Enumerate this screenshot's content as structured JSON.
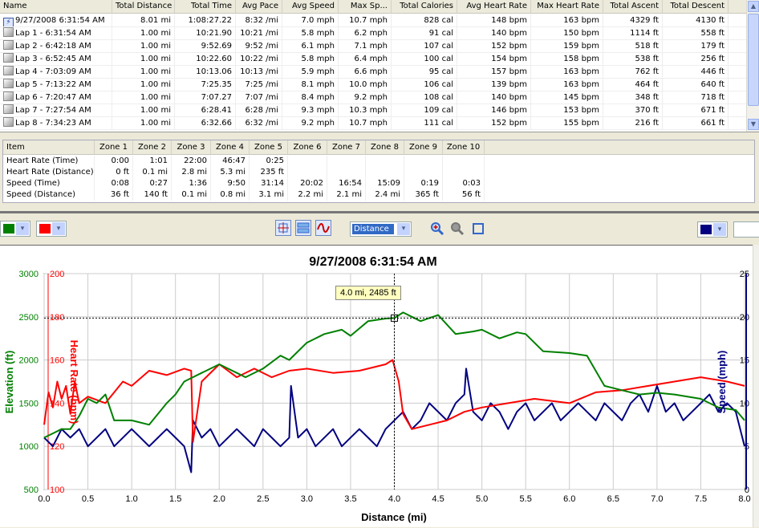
{
  "laps_table": {
    "columns": [
      "Name",
      "Total Distance",
      "Total Time",
      "Avg Pace",
      "Avg Speed",
      "Max Sp...",
      "Total Calories",
      "Avg Heart Rate",
      "Max Heart Rate",
      "Total Ascent",
      "Total Descent"
    ],
    "rows": [
      {
        "icon": "running-activity-icon",
        "cells": [
          "9/27/2008 6:31:54 AM",
          "8.01 mi",
          "1:08:27.22",
          "8:32 /mi",
          "7.0 mph",
          "10.7 mph",
          "828 cal",
          "148 bpm",
          "163 bpm",
          "4329 ft",
          "4130 ft"
        ]
      },
      {
        "icon": "lap-icon",
        "cells": [
          "Lap 1 - 6:31:54 AM",
          "1.00 mi",
          "10:21.90",
          "10:21 /mi",
          "5.8 mph",
          "6.2 mph",
          "91 cal",
          "140 bpm",
          "150 bpm",
          "1114 ft",
          "558 ft"
        ]
      },
      {
        "icon": "lap-icon",
        "cells": [
          "Lap 2 - 6:42:18 AM",
          "1.00 mi",
          "9:52.69",
          "9:52 /mi",
          "6.1 mph",
          "7.1 mph",
          "107 cal",
          "152 bpm",
          "159 bpm",
          "518 ft",
          "179 ft"
        ]
      },
      {
        "icon": "lap-icon",
        "cells": [
          "Lap 3 - 6:52:45 AM",
          "1.00 mi",
          "10:22.60",
          "10:22 /mi",
          "5.8 mph",
          "6.4 mph",
          "100 cal",
          "154 bpm",
          "158 bpm",
          "538 ft",
          "256 ft"
        ]
      },
      {
        "icon": "lap-icon",
        "cells": [
          "Lap 4 - 7:03:09 AM",
          "1.00 mi",
          "10:13.06",
          "10:13 /mi",
          "5.9 mph",
          "6.6 mph",
          "95 cal",
          "157 bpm",
          "163 bpm",
          "762 ft",
          "446 ft"
        ]
      },
      {
        "icon": "lap-icon",
        "cells": [
          "Lap 5 - 7:13:22 AM",
          "1.00 mi",
          "7:25.35",
          "7:25 /mi",
          "8.1 mph",
          "10.0 mph",
          "106 cal",
          "139 bpm",
          "163 bpm",
          "464 ft",
          "640 ft"
        ]
      },
      {
        "icon": "lap-icon",
        "cells": [
          "Lap 6 - 7:20:47 AM",
          "1.00 mi",
          "7:07.27",
          "7:07 /mi",
          "8.4 mph",
          "9.2 mph",
          "108 cal",
          "140 bpm",
          "145 bpm",
          "348 ft",
          "718 ft"
        ]
      },
      {
        "icon": "lap-icon",
        "cells": [
          "Lap 7 - 7:27:54 AM",
          "1.00 mi",
          "6:28.41",
          "6:28 /mi",
          "9.3 mph",
          "10.3 mph",
          "109 cal",
          "146 bpm",
          "153 bpm",
          "370 ft",
          "671 ft"
        ]
      },
      {
        "icon": "lap-icon",
        "cells": [
          "Lap 8 - 7:34:23 AM",
          "1.00 mi",
          "6:32.66",
          "6:32 /mi",
          "9.2 mph",
          "10.7 mph",
          "111 cal",
          "152 bpm",
          "155 bpm",
          "216 ft",
          "661 ft"
        ]
      }
    ]
  },
  "zones_table": {
    "columns": [
      "Item",
      "Zone 1",
      "Zone 2",
      "Zone 3",
      "Zone 4",
      "Zone 5",
      "Zone 6",
      "Zone 7",
      "Zone 8",
      "Zone 9",
      "Zone 10"
    ],
    "rows": [
      [
        "Heart Rate (Time)",
        "0:00",
        "1:01",
        "22:00",
        "46:47",
        "0:25",
        "",
        "",
        "",
        "",
        ""
      ],
      [
        "Heart Rate (Distance)",
        "0 ft",
        "0.1 mi",
        "2.8 mi",
        "5.3 mi",
        "235 ft",
        "",
        "",
        "",
        "",
        ""
      ],
      [
        "Speed (Time)",
        "0:08",
        "0:27",
        "1:36",
        "9:50",
        "31:14",
        "20:02",
        "16:54",
        "15:09",
        "0:19",
        "0:03"
      ],
      [
        "Speed (Distance)",
        "36 ft",
        "140 ft",
        "0.1 mi",
        "0.8 mi",
        "3.1 mi",
        "2.2 mi",
        "2.1 mi",
        "2.4 mi",
        "365 ft",
        "56 ft"
      ]
    ]
  },
  "toolbar": {
    "left_colors": [
      "#008000",
      "#ff0000"
    ],
    "right_colors": [
      "#000080",
      "#ffffff"
    ],
    "view_buttons": [
      "crosshair-icon",
      "split-chart-icon",
      "smoothing-icon"
    ],
    "x_axis_select": "Distance",
    "zoom_buttons": [
      "zoom-in-icon",
      "zoom-out-icon",
      "zoom-fit-icon"
    ]
  },
  "chart_data": {
    "type": "line",
    "title": "9/27/2008 6:31:54 AM",
    "xlabel": "Distance (mi)",
    "xlim": [
      0,
      8
    ],
    "xticks": [
      "0.0",
      "0.5",
      "1.0",
      "1.5",
      "2.0",
      "2.5",
      "3.0",
      "3.5",
      "4.0",
      "4.5",
      "5.0",
      "5.5",
      "6.0",
      "6.5",
      "7.0",
      "7.5",
      "8.0"
    ],
    "grid": true,
    "axes": {
      "elevation": {
        "label": "Elevation (ft)",
        "lim": [
          500,
          3000
        ],
        "ticks": [
          "3000",
          "2500",
          "2000",
          "1500",
          "1000",
          "500"
        ],
        "color": "#008000"
      },
      "heart_rate": {
        "label": "Heart Rate (bpm)",
        "lim": [
          100,
          200
        ],
        "ticks": [
          "200",
          "180",
          "160",
          "140",
          "120",
          "100"
        ],
        "color": "#ff0000"
      },
      "speed": {
        "label": "Speed (mph)",
        "lim": [
          0,
          25
        ],
        "ticks": [
          "25",
          "20",
          "15",
          "10",
          "5",
          "0"
        ],
        "color": "#000080"
      }
    },
    "series": [
      {
        "axis": "elevation",
        "x": [
          0,
          0.1,
          0.2,
          0.3,
          0.4,
          0.5,
          0.6,
          0.7,
          0.8,
          1.0,
          1.2,
          1.4,
          1.5,
          1.6,
          1.8,
          2.0,
          2.2,
          2.3,
          2.5,
          2.7,
          2.8,
          3.0,
          3.2,
          3.4,
          3.5,
          3.7,
          3.9,
          4.0,
          4.1,
          4.2,
          4.3,
          4.5,
          4.7,
          4.9,
          5.0,
          5.2,
          5.4,
          5.5,
          5.7,
          6.0,
          6.2,
          6.4,
          6.6,
          6.8,
          7.0,
          7.2,
          7.5,
          7.7,
          7.9,
          8.0
        ],
        "y": [
          1100,
          1150,
          1200,
          1200,
          1350,
          1550,
          1500,
          1600,
          1300,
          1300,
          1250,
          1500,
          1600,
          1750,
          1850,
          1950,
          1850,
          1800,
          1900,
          2050,
          2000,
          2200,
          2300,
          2350,
          2280,
          2450,
          2480,
          2485,
          2550,
          2500,
          2450,
          2520,
          2300,
          2330,
          2350,
          2250,
          2320,
          2300,
          2100,
          2080,
          2050,
          1700,
          1650,
          1600,
          1620,
          1600,
          1550,
          1450,
          1420,
          1300
        ]
      },
      {
        "axis": "heart_rate",
        "x": [
          0,
          0.05,
          0.1,
          0.15,
          0.2,
          0.25,
          0.3,
          0.35,
          0.4,
          0.5,
          0.7,
          0.9,
          1.0,
          1.2,
          1.4,
          1.6,
          1.68,
          1.7,
          1.8,
          2.0,
          2.2,
          2.4,
          2.6,
          2.8,
          3.0,
          3.3,
          3.6,
          3.9,
          3.98,
          4.05,
          4.1,
          4.2,
          4.4,
          4.6,
          4.8,
          5.0,
          5.3,
          5.6,
          6.0,
          6.3,
          6.6,
          6.9,
          7.2,
          7.5,
          7.8,
          8.0
        ],
        "y": [
          130,
          145,
          138,
          150,
          142,
          148,
          135,
          150,
          140,
          143,
          140,
          150,
          148,
          155,
          153,
          156,
          155,
          122,
          150,
          158,
          152,
          156,
          152,
          155,
          156,
          154,
          155,
          158,
          160,
          150,
          135,
          128,
          130,
          132,
          136,
          138,
          140,
          142,
          140,
          145,
          146,
          148,
          150,
          152,
          150,
          148
        ]
      },
      {
        "axis": "speed",
        "x": [
          0,
          0.1,
          0.2,
          0.3,
          0.4,
          0.5,
          0.6,
          0.7,
          0.8,
          0.9,
          1.0,
          1.1,
          1.2,
          1.3,
          1.4,
          1.5,
          1.6,
          1.68,
          1.7,
          1.8,
          1.9,
          2.0,
          2.1,
          2.2,
          2.3,
          2.4,
          2.5,
          2.6,
          2.7,
          2.8,
          2.82,
          2.9,
          3.0,
          3.1,
          3.2,
          3.3,
          3.4,
          3.5,
          3.6,
          3.7,
          3.8,
          3.9,
          4.0,
          4.1,
          4.2,
          4.3,
          4.4,
          4.5,
          4.6,
          4.7,
          4.8,
          4.82,
          4.9,
          5.0,
          5.1,
          5.2,
          5.3,
          5.4,
          5.5,
          5.6,
          5.7,
          5.8,
          5.9,
          6.0,
          6.1,
          6.2,
          6.3,
          6.4,
          6.5,
          6.6,
          6.7,
          6.8,
          6.9,
          7.0,
          7.1,
          7.2,
          7.3,
          7.4,
          7.5,
          7.6,
          7.7,
          7.8,
          7.9,
          8.0
        ],
        "y": [
          6,
          5,
          7,
          6,
          7,
          5,
          6,
          7,
          5,
          6,
          7,
          6,
          5,
          6,
          7,
          6,
          5,
          2,
          8,
          6,
          7,
          5,
          6,
          7,
          6,
          5,
          7,
          6,
          5,
          6,
          12,
          6,
          7,
          5,
          6,
          7,
          5,
          6,
          7,
          6,
          5,
          7,
          8,
          9,
          7,
          8,
          10,
          9,
          8,
          10,
          11,
          14,
          9,
          8,
          10,
          9,
          7,
          9,
          10,
          8,
          9,
          10,
          8,
          9,
          10,
          9,
          8,
          10,
          9,
          8,
          10,
          11,
          9,
          12,
          9,
          10,
          8,
          9,
          10,
          11,
          9,
          10,
          9,
          5
        ]
      }
    ],
    "crosshair": {
      "x": 4.0,
      "y": 2485,
      "label": "4.0 mi, 2485 ft"
    }
  }
}
